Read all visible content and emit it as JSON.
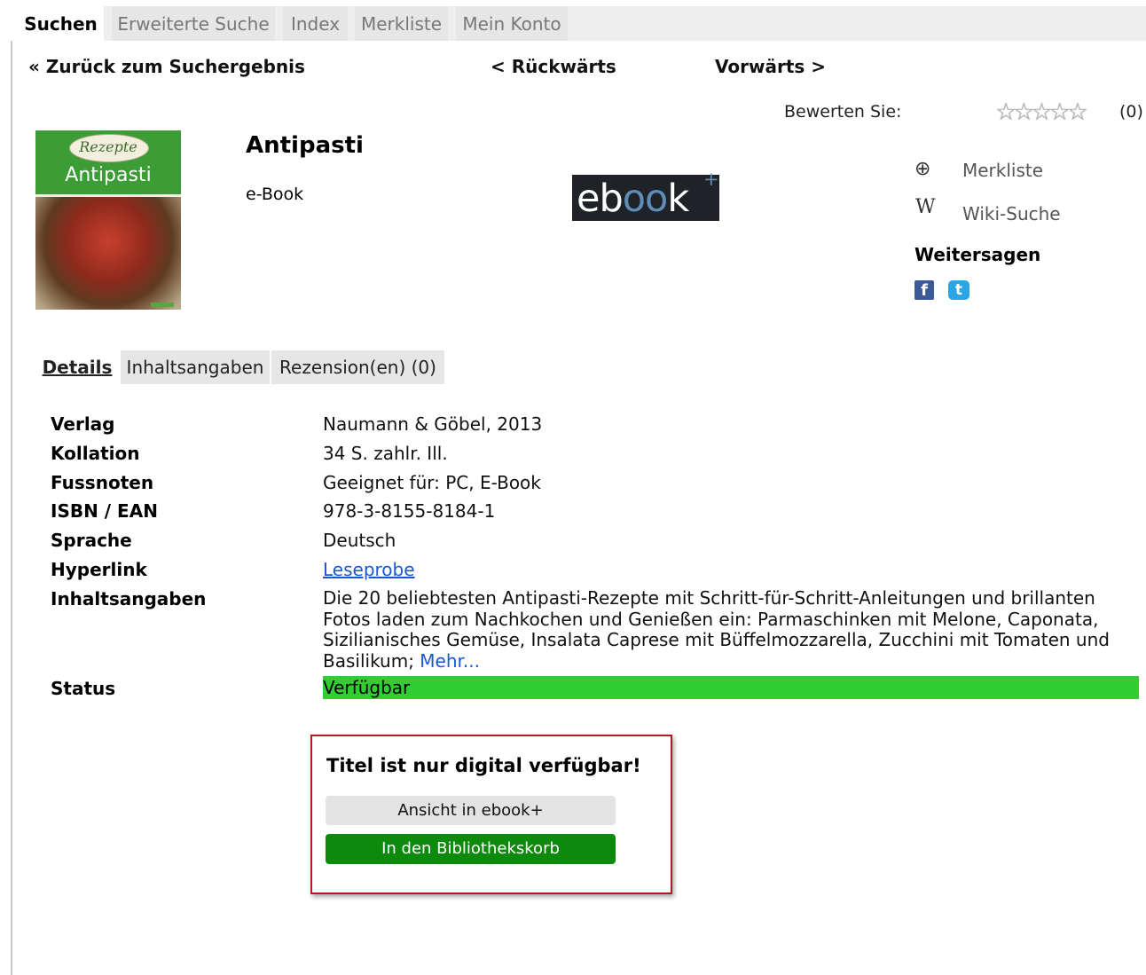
{
  "top_tabs": [
    "Suchen",
    "Erweiterte Suche",
    "Index",
    "Merkliste",
    "Mein Konto"
  ],
  "nav": {
    "back_to_results": "« Zurück zum Suchergebnis",
    "previous": "< Rückwärts",
    "next": "Vorwärts >"
  },
  "rating": {
    "label": "Bewerten Sie:",
    "stars": "☆☆☆☆☆",
    "value": 0,
    "count": "(0)"
  },
  "cover": {
    "series": "Rezepte",
    "title": "Antipasti"
  },
  "record": {
    "title": "Antipasti",
    "medium": "e-Book"
  },
  "logo": {
    "text_pre": "eb",
    "text_oo": "oo",
    "text_post": "k",
    "plus": "+"
  },
  "actions": {
    "merkliste_icon": "⊕",
    "merkliste": "Merkliste",
    "wiki_icon": "W",
    "wiki": "Wiki-Suche"
  },
  "share": {
    "title": "Weitersagen",
    "facebook_glyph": "f",
    "twitter_glyph": "t"
  },
  "detail_tabs": [
    "Details",
    "Inhaltsangaben",
    "Rezension(en) (0)"
  ],
  "details": {
    "verlag_label": "Verlag",
    "verlag": "Naumann & Göbel, 2013",
    "kollation_label": "Kollation",
    "kollation": "34 S. zahlr. Ill.",
    "fussnoten_label": "Fussnoten",
    "fussnoten": "Geeignet für: PC, E-Book",
    "isbn_label": "ISBN / EAN",
    "isbn": "978-3-8155-8184-1",
    "sprache_label": "Sprache",
    "sprache": "Deutsch",
    "hyperlink_label": "Hyperlink",
    "hyperlink": "Leseprobe",
    "inhalt_label": "Inhaltsangaben",
    "inhalt": "Die 20 beliebtesten Antipasti-Rezepte mit Schritt-für-Schritt-Anleitungen und brillanten Fotos laden zum Nachkochen und Genießen ein: Parmaschinken mit Melone, Caponata, Sizilianisches Gemüse, Insalata Caprese mit Büffelmozzarella, Zucchini mit Tomaten und Basilikum;",
    "mehr": "Mehr...",
    "status_label": "Status",
    "status": "Verfügbar"
  },
  "digital": {
    "title": "Titel ist nur digital verfügbar!",
    "view_button": "Ansicht in ebook+",
    "basket_button": "In den Bibliothekskorb"
  },
  "colors": {
    "status": "#32cd32",
    "basket": "#0b8a0b",
    "box_border": "#b51a1a",
    "link": "#1a57d3"
  }
}
